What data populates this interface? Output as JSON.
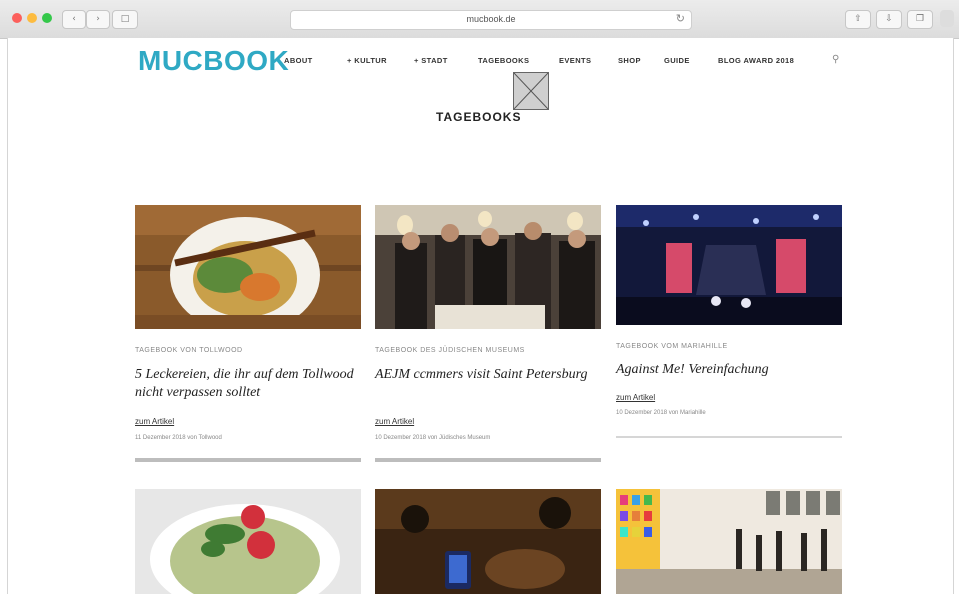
{
  "browser": {
    "url": "mucbook.de",
    "back_icon": "chevron-left-icon",
    "sidebar_icon": "sidebar-icon",
    "reload_icon": "reload-icon",
    "share_icon": "share-icon",
    "tabs_icon": "tabs-icon",
    "downloads_icon": "downloads-icon",
    "traffic_colors": [
      "#fc605c",
      "#fdbc40",
      "#34c84a"
    ]
  },
  "site": {
    "logo": "MUCBOOK",
    "brand_color": "#2fa9c4",
    "nav": [
      {
        "label": "ABOUT"
      },
      {
        "label": "+ KULTUR"
      },
      {
        "label": "+ STADT"
      },
      {
        "label": "TAGEBOOKS"
      },
      {
        "label": "EVENTS"
      },
      {
        "label": "SHOP"
      },
      {
        "label": "GUIDE"
      },
      {
        "label": "BLOG AWARD 2018"
      }
    ],
    "search_icon": "search-icon",
    "broken_image_icon": "broken-image-icon"
  },
  "page": {
    "title": "TAGEBOOKS"
  },
  "cards": [
    {
      "category": "TAGEBOOK VON TOLLWOOD",
      "headline": "5 Leckereien, die ihr auf dem Tollwood nicht verpassen solltet",
      "more": "zum Artikel",
      "meta": "11 Dezember 2018 von Tollwood"
    },
    {
      "category": "TAGEBOOK DES JÜDISCHEN MUSEUMS",
      "headline": "AEJM ccmmers visit Saint Petersburg",
      "more": "zum Artikel",
      "meta": "10 Dezember 2018 von Jüdisches Museum"
    },
    {
      "category": "TAGEBOOK VOM MARIAHILLE",
      "headline": "Against Me! Vereinfachung",
      "more": "zum Artikel",
      "meta": "10 Dezember 2018 von Mariahille"
    },
    {
      "category": "",
      "headline": "",
      "more": "",
      "meta": ""
    },
    {
      "category": "",
      "headline": "",
      "more": "",
      "meta": ""
    },
    {
      "category": "",
      "headline": "",
      "more": "",
      "meta": ""
    }
  ]
}
